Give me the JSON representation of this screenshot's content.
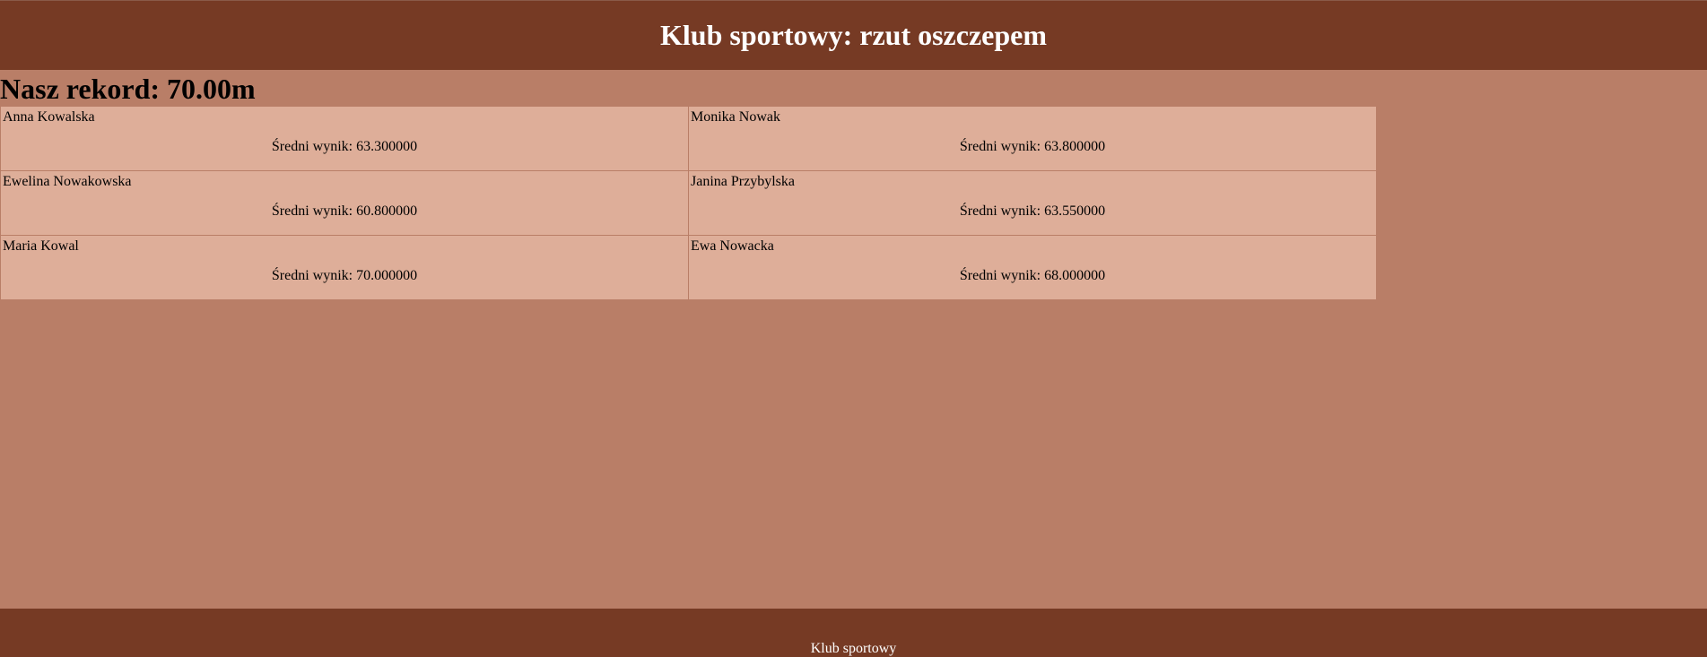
{
  "header": {
    "title": "Klub sportowy: rzut oszczepem"
  },
  "record": {
    "text": "Nasz rekord: 70.00m"
  },
  "athletes": [
    {
      "name": "Anna Kowalska",
      "score": "Średni wynik: 63.300000"
    },
    {
      "name": "Monika Nowak",
      "score": "Średni wynik: 63.800000"
    },
    {
      "name": "Ewelina Nowakowska",
      "score": "Średni wynik: 60.800000"
    },
    {
      "name": "Janina Przybylska",
      "score": "Średni wynik: 63.550000"
    },
    {
      "name": "Maria Kowal",
      "score": "Średni wynik: 70.000000"
    },
    {
      "name": "Ewa Nowacka",
      "score": "Średni wynik: 68.000000"
    }
  ],
  "footer": {
    "text": "Klub sportowy"
  },
  "colors": {
    "header_bg": "#763a24",
    "page_bg": "#b97e67",
    "cell_bg": "#deae99"
  }
}
